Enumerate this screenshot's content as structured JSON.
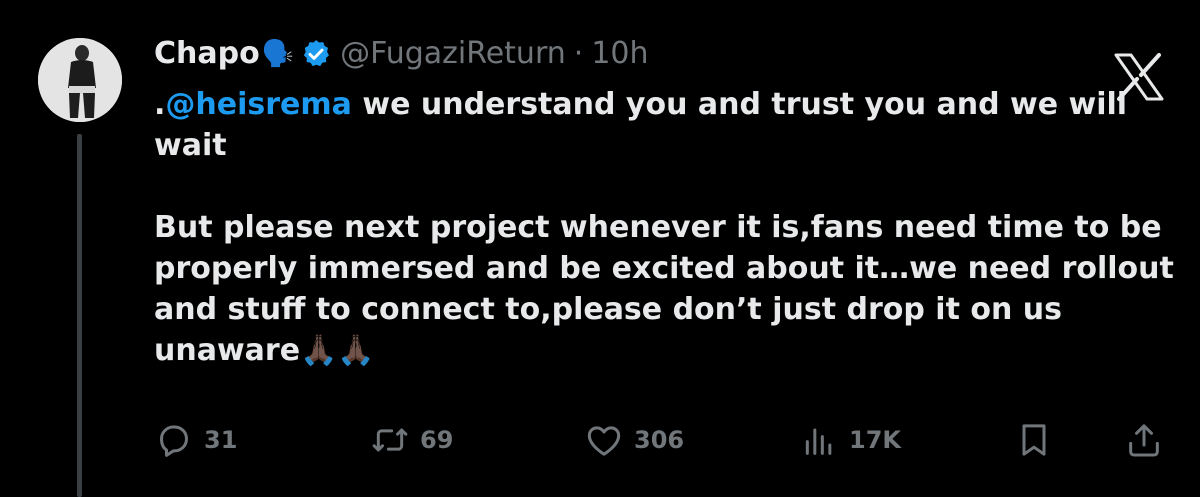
{
  "tweet": {
    "author_name": "Chapo",
    "author_emoji": "🗣️",
    "handle": "@FugaziReturn",
    "separator": "·",
    "time": "10h",
    "mention_prefix": ".",
    "mention": "@heisrema",
    "line1_rest": " we understand you and trust you and we will wait",
    "paragraph2": "But please next project whenever it is,fans need time to be properly immersed and be excited about it…we need rollout and stuff to connect to,please don’t just drop it on us unaware",
    "trailing_emoji": "🙏🏿🙏🏿"
  },
  "actions": {
    "replies": "31",
    "reposts": "69",
    "likes": "306",
    "views": "17K"
  },
  "icons": {
    "verified": "verified-badge-icon",
    "platform": "x-logo-icon",
    "reply": "reply-icon",
    "repost": "repost-icon",
    "like": "heart-icon",
    "views": "views-icon",
    "bookmark": "bookmark-icon",
    "share": "share-icon"
  },
  "colors": {
    "background": "#000000",
    "text": "#e7e9ea",
    "secondary": "#71767b",
    "accent": "#1d9bf0"
  }
}
